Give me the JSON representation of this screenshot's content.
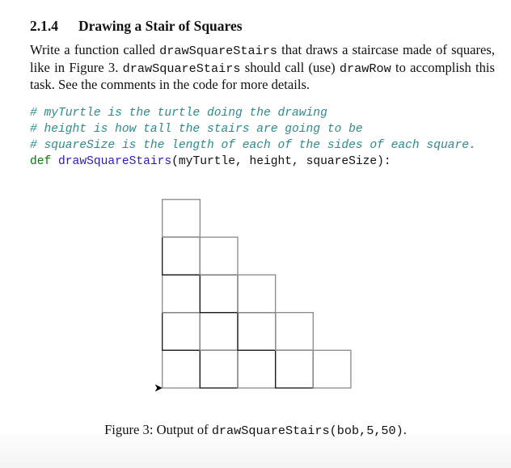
{
  "section": {
    "number": "2.1.4",
    "title": "Drawing a Stair of Squares"
  },
  "paragraph": {
    "p1": "Write a function called ",
    "fn1": "drawSquareStairs",
    "p2": " that draws a staircase made of squares, like in Figure 3. ",
    "fn2": "drawSquareStairs",
    "p3": " should call (use) ",
    "fn3": "drawRow",
    "p4": " to accomplish this task. See the comments in the code for more details."
  },
  "code": {
    "comments": [
      "# myTurtle is the turtle doing the drawing",
      "# height is how tall the stairs are going to be",
      "# squareSize is the length of each of the sides of each square."
    ],
    "keyword": "def",
    "function_name": "drawSquareStairs",
    "signature": "(myTurtle, height, squareSize):",
    "colors": {
      "comment": "#2e8b8b",
      "keyword": "#0a7a0a",
      "function": "#2a1ad0"
    }
  },
  "figure": {
    "description": "Turtle drawing of a staircase of squares",
    "height": 5,
    "square_size": 50,
    "rows_square_counts": [
      5,
      4,
      3,
      2,
      1
    ],
    "caption_prefix": "Figure 3: Output of ",
    "caption_code": "drawSquareStairs(bob,5,50)",
    "caption_suffix": "."
  }
}
